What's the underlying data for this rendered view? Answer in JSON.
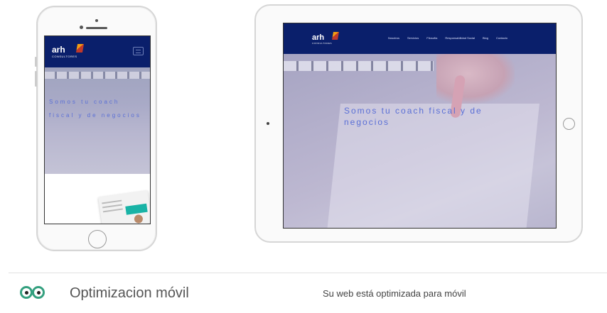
{
  "mobile_preview": {
    "logo_text": "arh",
    "logo_subtext": "CONSULTORES",
    "hero_line_1": "Somos tu coach",
    "hero_line_2": "fiscal y de negocios"
  },
  "tablet_preview": {
    "logo_text": "arh",
    "logo_subtext": "CONSULTORES",
    "nav_items": [
      "Nosotros",
      "Servicios",
      "Filosofía",
      "Responsabilidad Social",
      "Blog",
      "Contacto"
    ],
    "hero_line_1": "Somos tu coach fiscal y de",
    "hero_line_2": "negocios"
  },
  "feature": {
    "icon": "tripadvisor-owl-icon",
    "title": "Optimizacion móvil",
    "description": "Su web está optimizada para móvil"
  },
  "colors": {
    "nav_bg": "#0a1f6b",
    "hero_text": "#5a6fd6",
    "icon_green": "#34a07f"
  }
}
